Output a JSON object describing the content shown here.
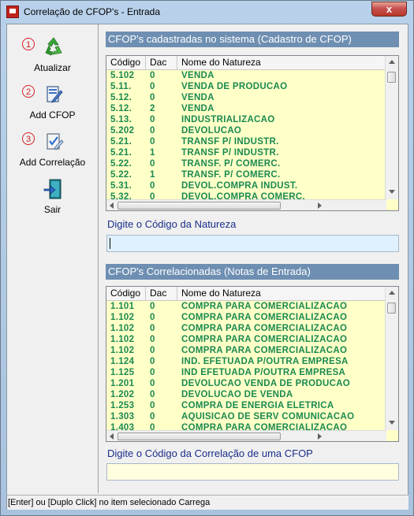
{
  "window": {
    "title": "Correlação de CFOP's - Entrada",
    "close_label": "x"
  },
  "toolbar": [
    {
      "number": "1",
      "label": "Atualizar",
      "icon": "recycle-icon"
    },
    {
      "number": "2",
      "label": "Add CFOP",
      "icon": "document-edit-icon"
    },
    {
      "number": "3",
      "label": "Add Correlação",
      "icon": "document-check-icon"
    },
    {
      "number": "",
      "label": "Sair",
      "icon": "exit-door-icon"
    }
  ],
  "cadastradas": {
    "header": "CFOP's cadastradas no sistema (Cadastro de CFOP)",
    "columns": [
      "Código",
      "Dac",
      "Nome do Natureza"
    ],
    "rows": [
      [
        "5.102",
        "0",
        "VENDA"
      ],
      [
        "5.11.",
        "0",
        "VENDA DE PRODUCAO"
      ],
      [
        "5.12.",
        "0",
        "VENDA"
      ],
      [
        "5.12.",
        "2",
        "VENDA"
      ],
      [
        "5.13.",
        "0",
        "INDUSTRIALIZACAO"
      ],
      [
        "5.202",
        "0",
        "DEVOLUCAO"
      ],
      [
        "5.21.",
        "0",
        "TRANSF P/ INDUSTR."
      ],
      [
        "5.21.",
        "1",
        "TRANSF P/ INDUSTR."
      ],
      [
        "5.22.",
        "0",
        "TRANSF. P/ COMERC."
      ],
      [
        "5.22.",
        "1",
        "TRANSF. P/ COMERC."
      ],
      [
        "5.31.",
        "0",
        "DEVOL.COMPRA INDUST."
      ],
      [
        "5.32.",
        "0",
        "DEVOL.COMPRA COMERC."
      ]
    ],
    "input_label": "Digite o Código da Natureza",
    "input_value": ""
  },
  "correlacionadas": {
    "header": "CFOP's Correlacionadas (Notas de Entrada)",
    "columns": [
      "Código",
      "Dac",
      "Nome do Natureza"
    ],
    "rows": [
      [
        "1.101",
        "0",
        "COMPRA PARA COMERCIALIZACAO"
      ],
      [
        "1.102",
        "0",
        "COMPRA PARA COMERCIALIZACAO"
      ],
      [
        "1.102",
        "0",
        "COMPRA PARA COMERCIALIZACAO"
      ],
      [
        "1.102",
        "0",
        "COMPRA PARA COMERCIALIZACAO"
      ],
      [
        "1.102",
        "0",
        "COMPRA PARA COMERCIALIZACAO"
      ],
      [
        "1.124",
        "0",
        "IND. EFETUADA P/OUTRA  EMPRESA"
      ],
      [
        "1.125",
        "0",
        "IND EFETUADA P/OUTRA EMPRESA"
      ],
      [
        "1.201",
        "0",
        "DEVOLUCAO VENDA DE PRODUCAO"
      ],
      [
        "1.202",
        "0",
        "DEVOLUCAO DE VENDA"
      ],
      [
        "1.253",
        "0",
        "COMPRA DE ENERGIA ELETRICA"
      ],
      [
        "1.303",
        "0",
        "AQUISICAO DE SERV  COMUNICACAO"
      ],
      [
        "1.403",
        "0",
        "COMPRA PARA COMERCIALIZACAO"
      ]
    ],
    "input_label": "Digite o Código da Correlação de uma CFOP",
    "input_value": ""
  },
  "status_bar": "[Enter] ou [Duplo Click] no item selecionado Carrega",
  "colors": {
    "section_header_bg": "#6e8fb2",
    "grid_bg": "#ffffc8",
    "row_text": "#1a8a50",
    "label_text": "#1a2e8a",
    "input_top_bg": "#dff0ff",
    "input_bottom_bg": "#ffffe0"
  }
}
